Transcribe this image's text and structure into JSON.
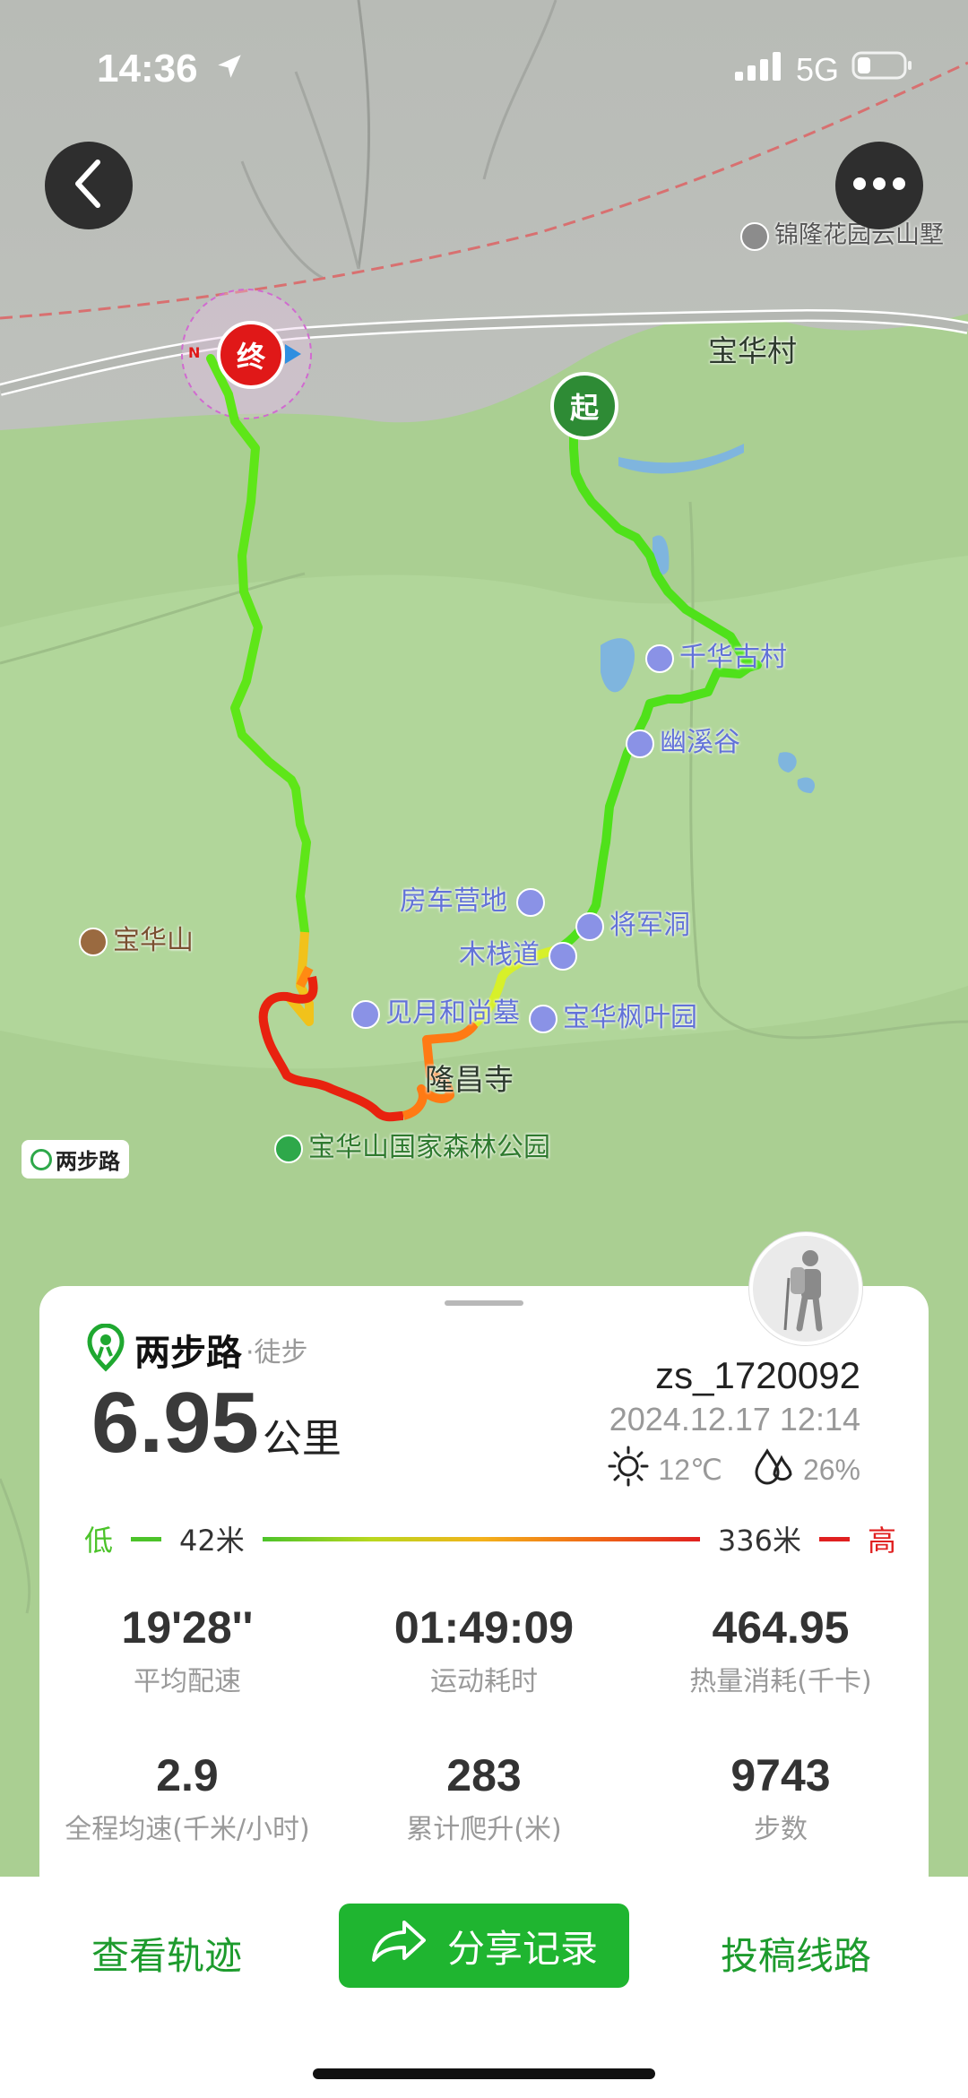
{
  "status_bar": {
    "time": "14:36",
    "network": "5G"
  },
  "map": {
    "labels": {
      "villa": "锦隆花园云山墅",
      "village": "宝华村",
      "qianhua": "千华古村",
      "youxi": "幽溪谷",
      "campsite": "房车营地",
      "jiangjun": "将军洞",
      "muzhan": "木栈道",
      "jianyue": "见月和尚墓",
      "fengye": "宝华枫叶园",
      "longchang": "隆昌寺",
      "mountain": "宝华山",
      "park": "宝华山国家森林公园",
      "watermark": "两步路"
    },
    "start_marker": "起",
    "end_marker": "终",
    "compass": "N"
  },
  "card": {
    "brand": "两步路",
    "activity": "·徒步",
    "username": "zs_1720092",
    "datetime": "2024.12.17 12:14",
    "temperature": "12℃",
    "humidity": "26%",
    "distance_value": "6.95",
    "distance_unit": "公里",
    "elevation": {
      "low_label": "低",
      "low_value": "42米",
      "high_value": "336米",
      "high_label": "高"
    },
    "stats": [
      {
        "value": "19'28''",
        "label": "平均配速"
      },
      {
        "value": "01:49:09",
        "label": "运动耗时"
      },
      {
        "value": "464.95",
        "label": "热量消耗(千卡)"
      },
      {
        "value": "2.9",
        "label": "全程均速(千米/小时)"
      },
      {
        "value": "283",
        "label": "累计爬升(米)"
      },
      {
        "value": "9743",
        "label": "步数"
      }
    ]
  },
  "bottom_bar": {
    "view_track": "查看轨迹",
    "share": "分享记录",
    "submit_route": "投稿线路"
  },
  "colors": {
    "accent_green": "#1fb530",
    "elevation_low": "#4cc32a",
    "elevation_high": "#e02020"
  }
}
